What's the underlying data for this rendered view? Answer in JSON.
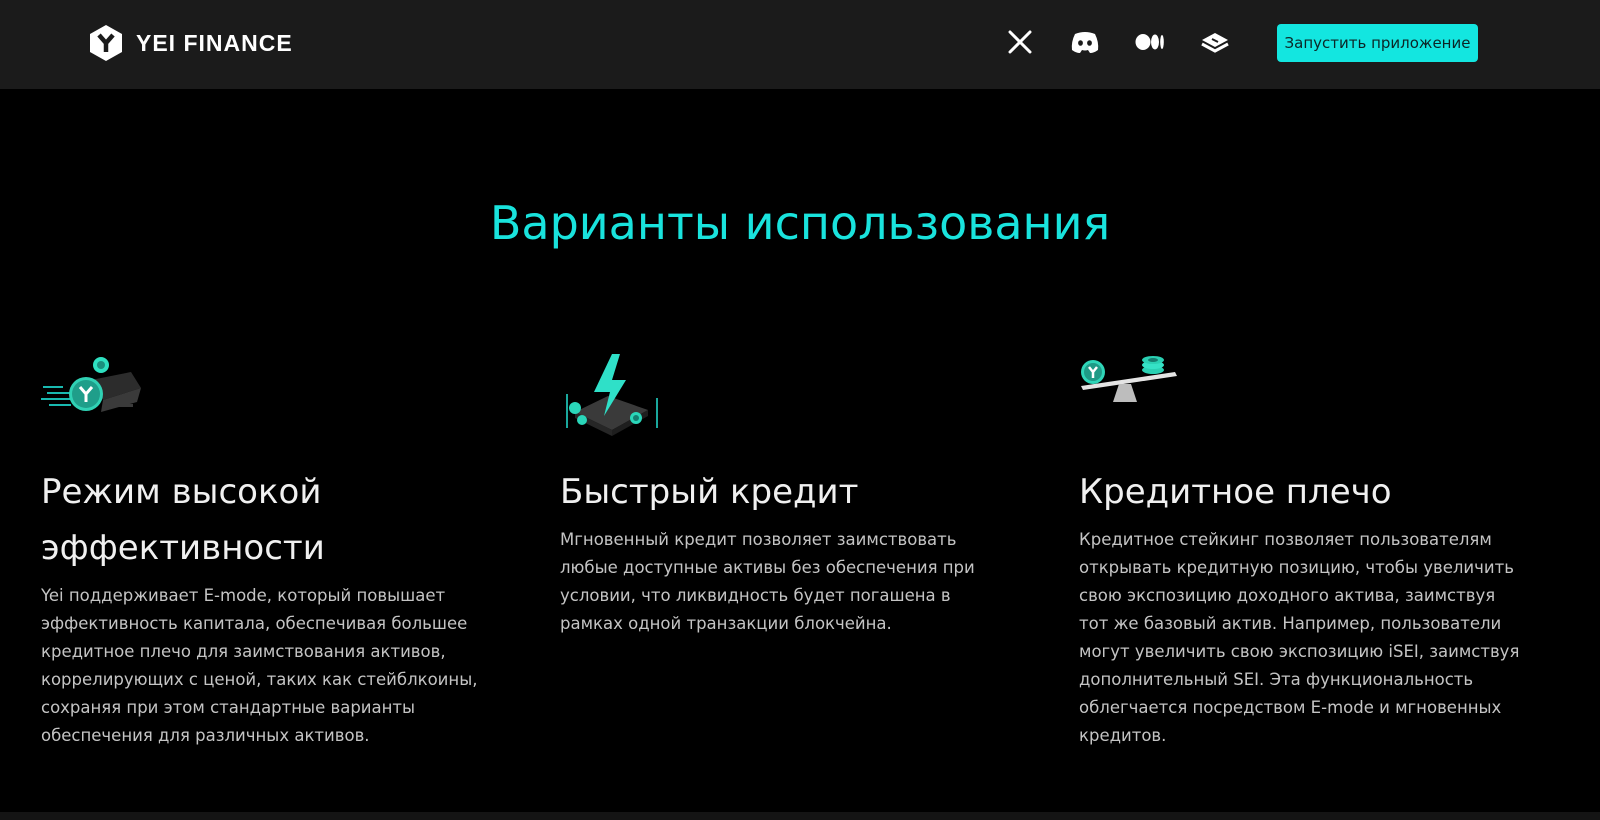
{
  "header": {
    "brand": "YEI FINANCE",
    "social": [
      "x-icon",
      "discord-icon",
      "medium-icon",
      "docs-icon"
    ],
    "launch_label": "Запустить приложение"
  },
  "colors": {
    "accent": "#13e6e0",
    "header_bg": "#1b1b1b",
    "page_bg": "#000000"
  },
  "main": {
    "title": "Варианты использования",
    "cards": [
      {
        "icon": "speed-coin-illustration",
        "title_line1": "Режим высокой",
        "title_line2": "эффективности",
        "description": "Yei поддерживает E-mode, который повышает эффективность капитала, обеспечивая большее кредитное плечо для заимствования активов, коррелирующих с ценой, таких как стейблкоины, сохраняя при этом стандартные варианты обеспечения для различных активов."
      },
      {
        "icon": "lightning-illustration",
        "title_line1": "Быстрый кредит",
        "description": "Мгновенный кредит позволяет заимствовать любые доступные активы без обеспечения при условии, что ликвидность будет погашена в рамках одной транзакции блокчейна."
      },
      {
        "icon": "balance-scale-illustration",
        "title_line1": "Кредитное плечо",
        "description": "Кредитное стейкинг позволяет пользователям открывать кредитную позицию, чтобы увеличить свою экспозицию доходного актива, заимствуя тот же базовый актив. Например, пользователи могут увеличить свою экспозицию iSEI, заимствуя дополнительный SEI. Эта функциональность облегчается посредством E-mode и мгновенных кредитов."
      }
    ]
  }
}
